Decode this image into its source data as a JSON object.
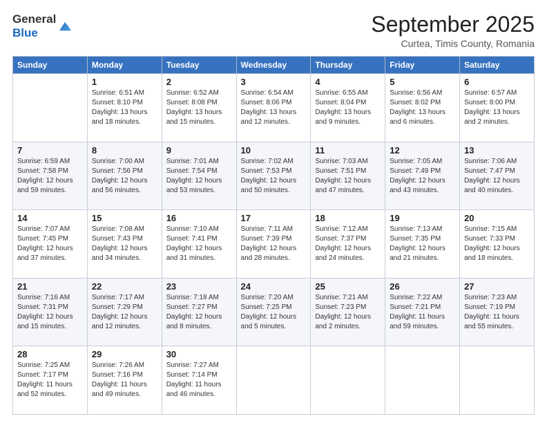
{
  "header": {
    "logo_general": "General",
    "logo_blue": "Blue",
    "title": "September 2025",
    "subtitle": "Curtea, Timis County, Romania"
  },
  "weekdays": [
    "Sunday",
    "Monday",
    "Tuesday",
    "Wednesday",
    "Thursday",
    "Friday",
    "Saturday"
  ],
  "weeks": [
    [
      {
        "day": "",
        "sunrise": "",
        "sunset": "",
        "daylight": ""
      },
      {
        "day": "1",
        "sunrise": "Sunrise: 6:51 AM",
        "sunset": "Sunset: 8:10 PM",
        "daylight": "Daylight: 13 hours and 18 minutes."
      },
      {
        "day": "2",
        "sunrise": "Sunrise: 6:52 AM",
        "sunset": "Sunset: 8:08 PM",
        "daylight": "Daylight: 13 hours and 15 minutes."
      },
      {
        "day": "3",
        "sunrise": "Sunrise: 6:54 AM",
        "sunset": "Sunset: 8:06 PM",
        "daylight": "Daylight: 13 hours and 12 minutes."
      },
      {
        "day": "4",
        "sunrise": "Sunrise: 6:55 AM",
        "sunset": "Sunset: 8:04 PM",
        "daylight": "Daylight: 13 hours and 9 minutes."
      },
      {
        "day": "5",
        "sunrise": "Sunrise: 6:56 AM",
        "sunset": "Sunset: 8:02 PM",
        "daylight": "Daylight: 13 hours and 6 minutes."
      },
      {
        "day": "6",
        "sunrise": "Sunrise: 6:57 AM",
        "sunset": "Sunset: 8:00 PM",
        "daylight": "Daylight: 13 hours and 2 minutes."
      }
    ],
    [
      {
        "day": "7",
        "sunrise": "Sunrise: 6:59 AM",
        "sunset": "Sunset: 7:58 PM",
        "daylight": "Daylight: 12 hours and 59 minutes."
      },
      {
        "day": "8",
        "sunrise": "Sunrise: 7:00 AM",
        "sunset": "Sunset: 7:56 PM",
        "daylight": "Daylight: 12 hours and 56 minutes."
      },
      {
        "day": "9",
        "sunrise": "Sunrise: 7:01 AM",
        "sunset": "Sunset: 7:54 PM",
        "daylight": "Daylight: 12 hours and 53 minutes."
      },
      {
        "day": "10",
        "sunrise": "Sunrise: 7:02 AM",
        "sunset": "Sunset: 7:53 PM",
        "daylight": "Daylight: 12 hours and 50 minutes."
      },
      {
        "day": "11",
        "sunrise": "Sunrise: 7:03 AM",
        "sunset": "Sunset: 7:51 PM",
        "daylight": "Daylight: 12 hours and 47 minutes."
      },
      {
        "day": "12",
        "sunrise": "Sunrise: 7:05 AM",
        "sunset": "Sunset: 7:49 PM",
        "daylight": "Daylight: 12 hours and 43 minutes."
      },
      {
        "day": "13",
        "sunrise": "Sunrise: 7:06 AM",
        "sunset": "Sunset: 7:47 PM",
        "daylight": "Daylight: 12 hours and 40 minutes."
      }
    ],
    [
      {
        "day": "14",
        "sunrise": "Sunrise: 7:07 AM",
        "sunset": "Sunset: 7:45 PM",
        "daylight": "Daylight: 12 hours and 37 minutes."
      },
      {
        "day": "15",
        "sunrise": "Sunrise: 7:08 AM",
        "sunset": "Sunset: 7:43 PM",
        "daylight": "Daylight: 12 hours and 34 minutes."
      },
      {
        "day": "16",
        "sunrise": "Sunrise: 7:10 AM",
        "sunset": "Sunset: 7:41 PM",
        "daylight": "Daylight: 12 hours and 31 minutes."
      },
      {
        "day": "17",
        "sunrise": "Sunrise: 7:11 AM",
        "sunset": "Sunset: 7:39 PM",
        "daylight": "Daylight: 12 hours and 28 minutes."
      },
      {
        "day": "18",
        "sunrise": "Sunrise: 7:12 AM",
        "sunset": "Sunset: 7:37 PM",
        "daylight": "Daylight: 12 hours and 24 minutes."
      },
      {
        "day": "19",
        "sunrise": "Sunrise: 7:13 AM",
        "sunset": "Sunset: 7:35 PM",
        "daylight": "Daylight: 12 hours and 21 minutes."
      },
      {
        "day": "20",
        "sunrise": "Sunrise: 7:15 AM",
        "sunset": "Sunset: 7:33 PM",
        "daylight": "Daylight: 12 hours and 18 minutes."
      }
    ],
    [
      {
        "day": "21",
        "sunrise": "Sunrise: 7:16 AM",
        "sunset": "Sunset: 7:31 PM",
        "daylight": "Daylight: 12 hours and 15 minutes."
      },
      {
        "day": "22",
        "sunrise": "Sunrise: 7:17 AM",
        "sunset": "Sunset: 7:29 PM",
        "daylight": "Daylight: 12 hours and 12 minutes."
      },
      {
        "day": "23",
        "sunrise": "Sunrise: 7:18 AM",
        "sunset": "Sunset: 7:27 PM",
        "daylight": "Daylight: 12 hours and 8 minutes."
      },
      {
        "day": "24",
        "sunrise": "Sunrise: 7:20 AM",
        "sunset": "Sunset: 7:25 PM",
        "daylight": "Daylight: 12 hours and 5 minutes."
      },
      {
        "day": "25",
        "sunrise": "Sunrise: 7:21 AM",
        "sunset": "Sunset: 7:23 PM",
        "daylight": "Daylight: 12 hours and 2 minutes."
      },
      {
        "day": "26",
        "sunrise": "Sunrise: 7:22 AM",
        "sunset": "Sunset: 7:21 PM",
        "daylight": "Daylight: 11 hours and 59 minutes."
      },
      {
        "day": "27",
        "sunrise": "Sunrise: 7:23 AM",
        "sunset": "Sunset: 7:19 PM",
        "daylight": "Daylight: 11 hours and 55 minutes."
      }
    ],
    [
      {
        "day": "28",
        "sunrise": "Sunrise: 7:25 AM",
        "sunset": "Sunset: 7:17 PM",
        "daylight": "Daylight: 11 hours and 52 minutes."
      },
      {
        "day": "29",
        "sunrise": "Sunrise: 7:26 AM",
        "sunset": "Sunset: 7:16 PM",
        "daylight": "Daylight: 11 hours and 49 minutes."
      },
      {
        "day": "30",
        "sunrise": "Sunrise: 7:27 AM",
        "sunset": "Sunset: 7:14 PM",
        "daylight": "Daylight: 11 hours and 46 minutes."
      },
      {
        "day": "",
        "sunrise": "",
        "sunset": "",
        "daylight": ""
      },
      {
        "day": "",
        "sunrise": "",
        "sunset": "",
        "daylight": ""
      },
      {
        "day": "",
        "sunrise": "",
        "sunset": "",
        "daylight": ""
      },
      {
        "day": "",
        "sunrise": "",
        "sunset": "",
        "daylight": ""
      }
    ]
  ]
}
